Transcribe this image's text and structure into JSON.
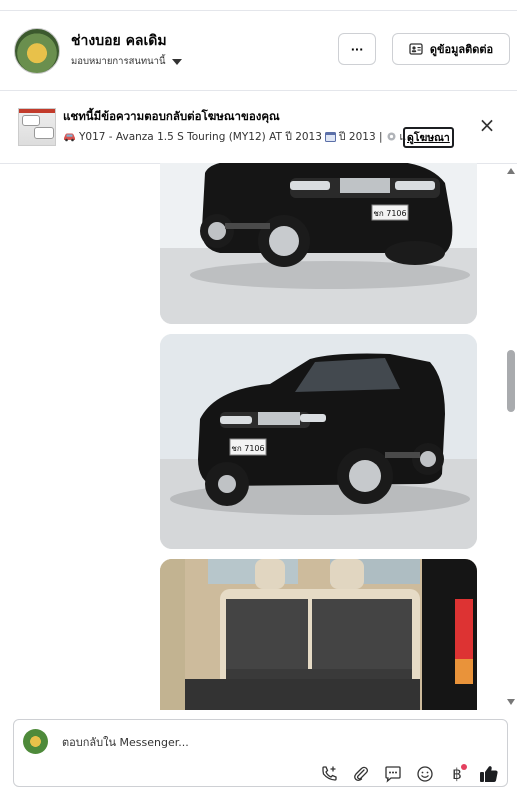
{
  "header": {
    "name": "ช่างบอย คลเดิม",
    "assignment": "มอบหมายการสนทนานี้",
    "more_label": "···",
    "contact_label": "ดูข้อมูลติดต่อ"
  },
  "banner": {
    "title": "แชทนี้มีข้อความตอบกลับต่อโฆษณาของคุณ",
    "ad_code": "Y017 - Avanza 1.5 S Touring (MY12) AT ปี 2013",
    "year_text": "ปี 2013 |",
    "ellipsis": "เ...",
    "ad_link": "ดูโฆษณา",
    "close_label": "×"
  },
  "plates": {
    "plate1": "ชก 7106",
    "plate2": "ชก 7106"
  },
  "composer": {
    "placeholder": "ตอบกลับใน Messenger..."
  },
  "icons": [
    "menu-dots-icon",
    "contact-card-icon",
    "close-icon",
    "car-icon",
    "calendar-icon",
    "gear-icon",
    "call-add-icon",
    "paperclip-icon",
    "chat-bubble-icon",
    "emoji-icon",
    "baht-icon",
    "thumbs-up-icon"
  ],
  "colors": {
    "accent": "#050505",
    "notification": "#e4405f"
  }
}
